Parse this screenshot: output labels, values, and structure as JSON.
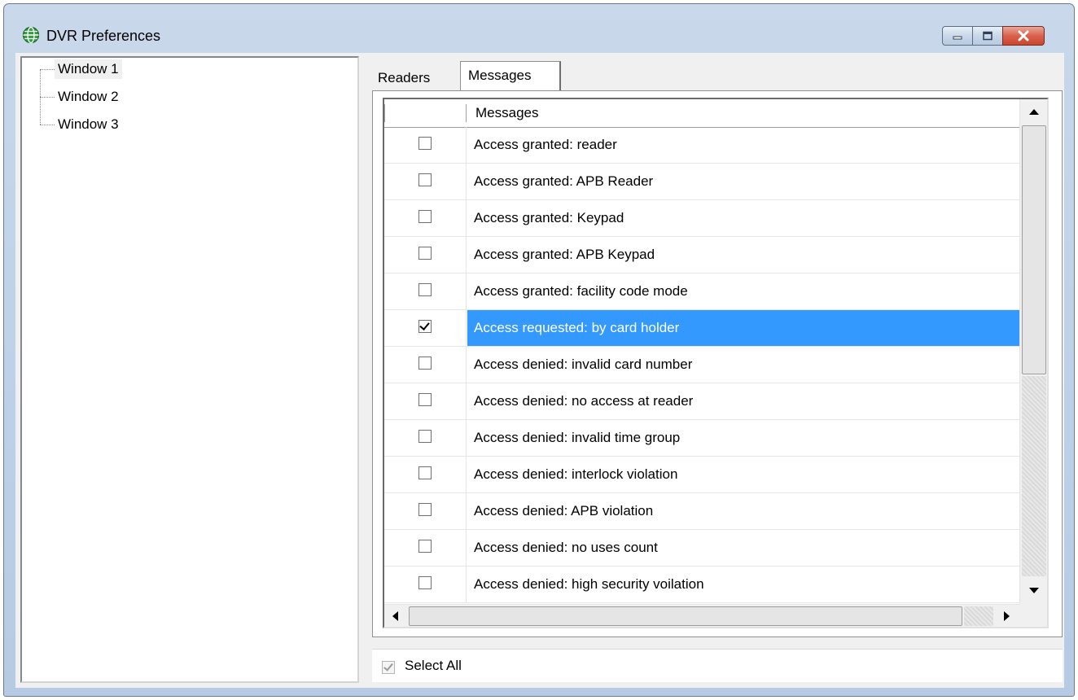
{
  "window": {
    "title": "DVR Preferences"
  },
  "tree": {
    "items": [
      {
        "label": "Window 1",
        "selected": true
      },
      {
        "label": "Window 2",
        "selected": false
      },
      {
        "label": "Window 3",
        "selected": false
      }
    ]
  },
  "tabs": [
    {
      "label": "Readers",
      "active": false
    },
    {
      "label": "Messages",
      "active": true
    }
  ],
  "grid": {
    "columns": [
      "",
      "Messages"
    ],
    "rows": [
      {
        "checked": false,
        "message": "Access granted: reader"
      },
      {
        "checked": false,
        "message": "Access granted: APB Reader"
      },
      {
        "checked": false,
        "message": "Access granted: Keypad"
      },
      {
        "checked": false,
        "message": "Access granted: APB Keypad"
      },
      {
        "checked": false,
        "message": "Access granted: facility code mode"
      },
      {
        "checked": true,
        "message": "Access requested: by card holder",
        "selected": true
      },
      {
        "checked": false,
        "message": "Access denied: invalid card number"
      },
      {
        "checked": false,
        "message": "Access denied: no access at reader"
      },
      {
        "checked": false,
        "message": "Access denied: invalid time group"
      },
      {
        "checked": false,
        "message": "Access denied: interlock violation"
      },
      {
        "checked": false,
        "message": "Access denied: APB violation"
      },
      {
        "checked": false,
        "message": "Access denied: no uses count"
      },
      {
        "checked": false,
        "message": "Access denied: high security voilation"
      }
    ]
  },
  "select_all": {
    "label": "Select All",
    "checked": true,
    "disabled": true
  },
  "colors": {
    "selection": "#3399ff",
    "close_button": "#d9614c"
  },
  "icons": {
    "app": "globe-icon",
    "minimize": "minimize-icon",
    "maximize": "maximize-icon",
    "close": "close-icon"
  }
}
